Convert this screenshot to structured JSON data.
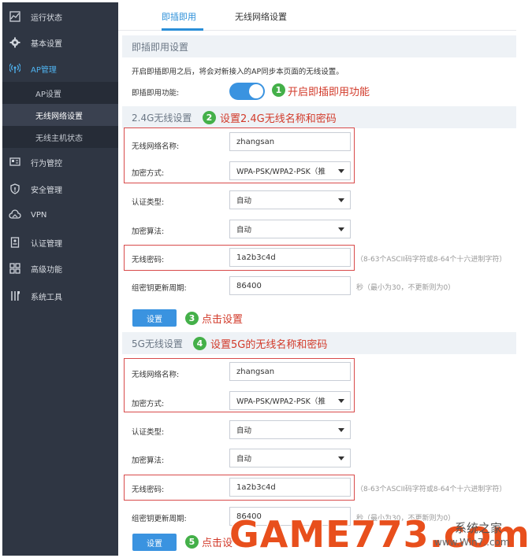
{
  "sidebar": {
    "items": [
      {
        "label": "运行状态",
        "icon": "status-chart-icon"
      },
      {
        "label": "基本设置",
        "icon": "gear-icon"
      },
      {
        "label": "AP管理",
        "icon": "wireless-ap-icon"
      },
      {
        "label": "行为管控",
        "icon": "behavior-control-icon"
      },
      {
        "label": "安全管理",
        "icon": "shield-icon"
      },
      {
        "label": "VPN",
        "icon": "cloud-vpn-icon"
      },
      {
        "label": "认证管理",
        "icon": "auth-id-icon"
      },
      {
        "label": "高级功能",
        "icon": "grid-advanced-icon"
      },
      {
        "label": "系统工具",
        "icon": "tools-icon"
      }
    ],
    "sub_items": [
      {
        "label": "AP设置"
      },
      {
        "label": "无线网络设置"
      },
      {
        "label": "无线主机状态"
      }
    ],
    "active_color": "#4fb3f0"
  },
  "tabs": [
    {
      "label": "即插即用"
    },
    {
      "label": "无线网络设置"
    }
  ],
  "plug_and_play": {
    "section_title": "即插即用设置",
    "description": "开启即插即用之后，将会对新接入的AP同步本页面的无线设置。",
    "toggle_label": "即插即用功能:",
    "enabled": true,
    "annotation": "开启即插即用功能",
    "step": "1"
  },
  "band_24g": {
    "section_title": "2.4G无线设置",
    "step": "2",
    "annotation": "设置2.4G无线名称和密码",
    "ssid_label": "无线网络名称:",
    "ssid_value": "zhangsan",
    "encryption_label": "加密方式:",
    "encryption_value": "WPA-PSK/WPA2-PSK（推",
    "auth_label": "认证类型:",
    "auth_value": "自动",
    "algo_label": "加密算法:",
    "algo_value": "自动",
    "password_label": "无线密码:",
    "password_value": "1a2b3c4d",
    "password_hint": "（8-63个ASCII码字符或8-64个十六进制字符）",
    "rekey_label": "组密钥更新周期:",
    "rekey_value": "86400",
    "rekey_hint": "秒（最小为30，不更新则为0）",
    "save_label": "设置",
    "save_step": "3",
    "save_annotation": "点击设置"
  },
  "band_5g": {
    "section_title": "5G无线设置",
    "step": "4",
    "annotation": "设置5G的无线名称和密码",
    "ssid_label": "无线网络名称:",
    "ssid_value": "zhangsan",
    "encryption_label": "加密方式:",
    "encryption_value": "WPA-PSK/WPA2-PSK（推",
    "auth_label": "认证类型:",
    "auth_value": "自动",
    "algo_label": "加密算法:",
    "algo_value": "自动",
    "password_label": "无线密码:",
    "password_value": "1a2b3c4d",
    "password_hint": "（8-63个ASCII码字符或8-64个十六进制字符）",
    "rekey_label": "组密钥更新周期:",
    "rekey_value": "86400",
    "rekey_hint": "秒（最小为30，不更新则为0）",
    "save_label": "设置",
    "save_step": "5",
    "save_annotation": "点击设"
  },
  "watermark": {
    "main": "GAME773.com",
    "side": "系统之家",
    "url": "www.Win7..com"
  },
  "colors": {
    "sidebar_bg": "#2f3643",
    "accent": "#3a93e0",
    "annotation_red": "#d23a2a",
    "step_green": "#44b049"
  }
}
